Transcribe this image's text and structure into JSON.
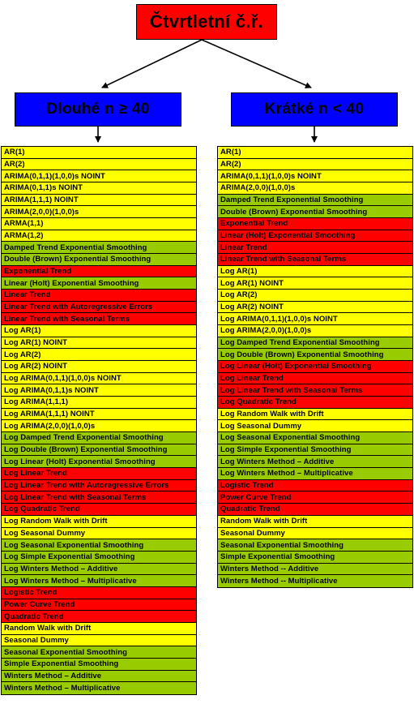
{
  "title": "Čtvrtletní č.ř.",
  "colors": {
    "root_box": "#FF0000",
    "branch_box": "#0000FF",
    "yellow": "#FFFF00",
    "green": "#99CC00",
    "red": "#FF0000",
    "border": "#000000",
    "background": "#FFFFFF"
  },
  "nodes": {
    "root": {
      "label": "Čtvrtletní č.ř."
    },
    "left": {
      "label": "Dlouhé n ≥ 40"
    },
    "right": {
      "label": "Krátké n < 40"
    }
  },
  "left_list": [
    {
      "label": "AR(1)",
      "color": "yellow"
    },
    {
      "label": "AR(2)",
      "color": "yellow"
    },
    {
      "label": "ARIMA(0,1,1)(1,0,0)s NOINT",
      "color": "yellow"
    },
    {
      "label": "ARIMA(0,1,1)s NOINT",
      "color": "yellow"
    },
    {
      "label": "ARIMA(1,1,1) NOINT",
      "color": "yellow"
    },
    {
      "label": "ARIMA(2,0,0)(1,0,0)s",
      "color": "yellow"
    },
    {
      "label": "ARMA(1,1)",
      "color": "yellow"
    },
    {
      "label": "ARMA(1,2)",
      "color": "yellow"
    },
    {
      "label": "Damped Trend Exponential Smoothing",
      "color": "green"
    },
    {
      "label": "Double (Brown) Exponential Smoothing",
      "color": "green"
    },
    {
      "label": "Exponential Trend",
      "color": "red"
    },
    {
      "label": "Linear (Holt) Exponential Smoothing",
      "color": "green"
    },
    {
      "label": "Linear Trend",
      "color": "red"
    },
    {
      "label": "Linear Trend with Autoregressive Errors",
      "color": "red"
    },
    {
      "label": "Linear Trend with Seasonal Terms",
      "color": "red"
    },
    {
      "label": "Log AR(1)",
      "color": "yellow"
    },
    {
      "label": "Log AR(1) NOINT",
      "color": "yellow"
    },
    {
      "label": "Log AR(2)",
      "color": "yellow"
    },
    {
      "label": "Log AR(2) NOINT",
      "color": "yellow"
    },
    {
      "label": "Log ARIMA(0,1,1)(1,0,0)s NOINT",
      "color": "yellow"
    },
    {
      "label": "Log ARIMA(0,1,1)s NOINT",
      "color": "yellow"
    },
    {
      "label": "Log ARIMA(1,1,1)",
      "color": "yellow"
    },
    {
      "label": "Log ARIMA(1,1,1) NOINT",
      "color": "yellow"
    },
    {
      "label": "Log ARIMA(2,0,0)(1,0,0)s",
      "color": "yellow"
    },
    {
      "label": "Log Damped Trend Exponential Smoothing",
      "color": "green"
    },
    {
      "label": "Log Double (Brown) Exponential Smoothing",
      "color": "green"
    },
    {
      "label": "Log Linear (Holt) Exponential Smoothing",
      "color": "green"
    },
    {
      "label": "Log Linear Trend",
      "color": "red"
    },
    {
      "label": "Log Linear Trend with Autoregressive Errors",
      "color": "red"
    },
    {
      "label": "Log Linear Trend with Seasonal Terms",
      "color": "red"
    },
    {
      "label": "Log Quadratic Trend",
      "color": "red"
    },
    {
      "label": "Log Random Walk with Drift",
      "color": "yellow"
    },
    {
      "label": "Log Seasonal Dummy",
      "color": "yellow"
    },
    {
      "label": "Log Seasonal Exponential Smoothing",
      "color": "green"
    },
    {
      "label": "Log Simple Exponential Smoothing",
      "color": "green"
    },
    {
      "label": "Log Winters Method – Additive",
      "color": "green"
    },
    {
      "label": "Log Winters Method – Multiplicative",
      "color": "green"
    },
    {
      "label": "Logistic Trend",
      "color": "red"
    },
    {
      "label": "Power Curve Trend",
      "color": "red"
    },
    {
      "label": "Quadratic Trend",
      "color": "red"
    },
    {
      "label": "Random Walk with Drift",
      "color": "yellow"
    },
    {
      "label": "Seasonal Dummy",
      "color": "yellow"
    },
    {
      "label": "Seasonal Exponential Smoothing",
      "color": "green"
    },
    {
      "label": "Simple Exponential Smoothing",
      "color": "green"
    },
    {
      "label": "Winters Method – Additive",
      "color": "green"
    },
    {
      "label": "Winters Method – Multiplicative",
      "color": "green"
    }
  ],
  "right_list": [
    {
      "label": "AR(1)",
      "color": "yellow"
    },
    {
      "label": "AR(2)",
      "color": "yellow"
    },
    {
      "label": "ARIMA(0,1,1)(1,0,0)s NOINT",
      "color": "yellow"
    },
    {
      "label": "ARIMA(2,0,0)(1,0,0)s",
      "color": "yellow"
    },
    {
      "label": "Damped Trend Exponential Smoothing",
      "color": "green"
    },
    {
      "label": "Double (Brown) Exponential Smoothing",
      "color": "green"
    },
    {
      "label": "Exponential Trend",
      "color": "red"
    },
    {
      "label": "Linear (Holt) Exponential Smoothing",
      "color": "red"
    },
    {
      "label": "Linear Trend",
      "color": "red"
    },
    {
      "label": "Linear Trend with Seasonal Terms",
      "color": "red"
    },
    {
      "label": "Log AR(1)",
      "color": "yellow"
    },
    {
      "label": "Log AR(1) NOINT",
      "color": "yellow"
    },
    {
      "label": "Log AR(2)",
      "color": "yellow"
    },
    {
      "label": "Log AR(2) NOINT",
      "color": "yellow"
    },
    {
      "label": "Log ARIMA(0,1,1)(1,0,0)s NOINT",
      "color": "yellow"
    },
    {
      "label": "Log ARIMA(2,0,0)(1,0,0)s",
      "color": "yellow"
    },
    {
      "label": "Log Damped Trend Exponential Smoothing",
      "color": "green"
    },
    {
      "label": "Log Double (Brown) Exponential Smoothing",
      "color": "green"
    },
    {
      "label": "Log Linear (Holt) Exponential Smoothing",
      "color": "red"
    },
    {
      "label": "Log Linear Trend",
      "color": "red"
    },
    {
      "label": "Log Linear Trend with Seasonal Terms",
      "color": "red"
    },
    {
      "label": "Log Quadratic Trend",
      "color": "red"
    },
    {
      "label": "Log Random Walk with Drift",
      "color": "yellow"
    },
    {
      "label": "Log Seasonal Dummy",
      "color": "yellow"
    },
    {
      "label": "Log Seasonal Exponential Smoothing",
      "color": "green"
    },
    {
      "label": "Log Simple Exponential Smoothing",
      "color": "green"
    },
    {
      "label": "Log Winters Method – Additive",
      "color": "green"
    },
    {
      "label": "Log Winters Method – Multiplicative",
      "color": "green"
    },
    {
      "label": "Logistic Trend",
      "color": "red"
    },
    {
      "label": "Power Curve Trend",
      "color": "red"
    },
    {
      "label": "Quadratic Trend",
      "color": "red"
    },
    {
      "label": "Random Walk with Drift",
      "color": "yellow"
    },
    {
      "label": "Seasonal Dummy",
      "color": "yellow"
    },
    {
      "label": "Seasonal Exponential Smoothing",
      "color": "green"
    },
    {
      "label": "Simple Exponential Smoothing",
      "color": "green"
    },
    {
      "label": "Winters Method -- Additive",
      "color": "green"
    },
    {
      "label": "Winters Method -- Multiplicative",
      "color": "green"
    }
  ]
}
